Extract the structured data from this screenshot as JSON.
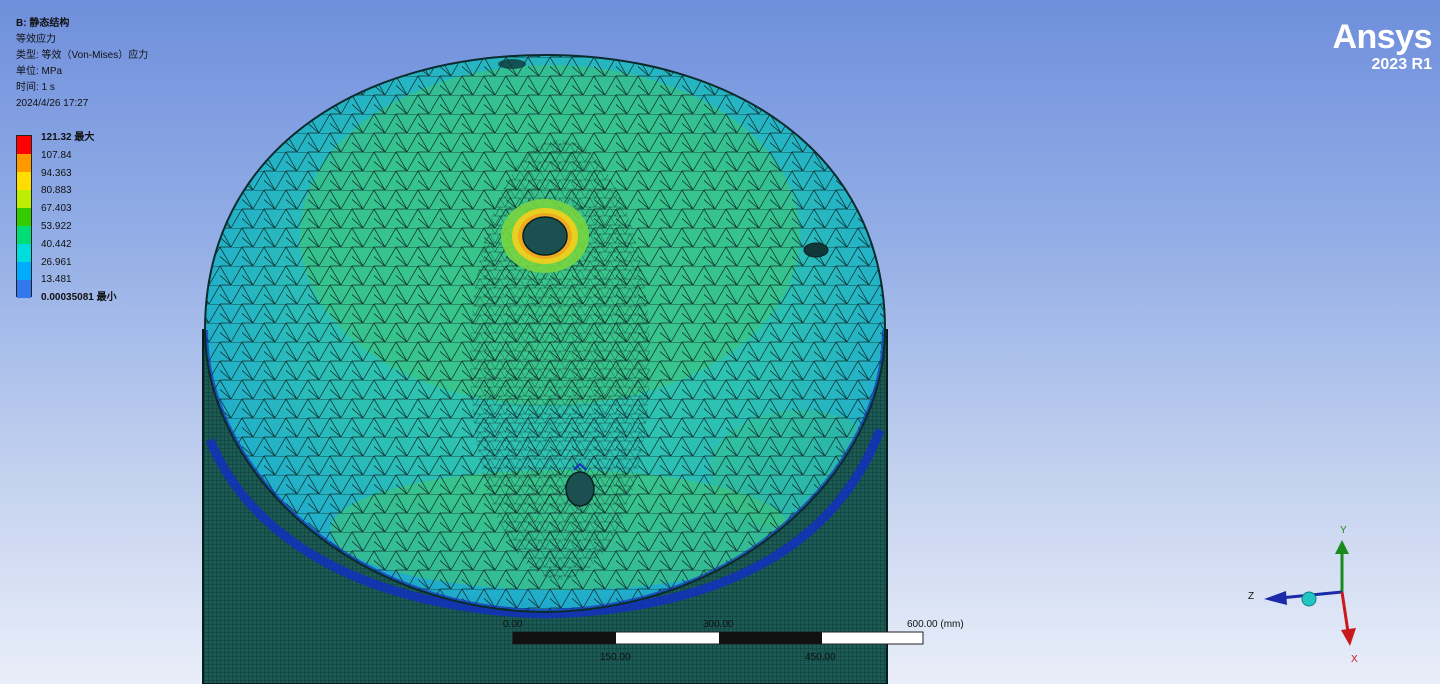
{
  "info": {
    "title": "B: 静态结构",
    "result": "等效应力",
    "type": "类型: 等效（Von-Mises）应力",
    "unit": "单位: MPa",
    "time": "时间: 1 s",
    "date": "2024/4/26 17:27"
  },
  "legend": {
    "labels": [
      "121.32 最大",
      "107.84",
      "94.363",
      "80.883",
      "67.403",
      "53.922",
      "40.442",
      "26.961",
      "13.481",
      "0.00035081 最小"
    ],
    "colors": [
      "#ff0000",
      "#ff9900",
      "#ffdd00",
      "#bbee00",
      "#33cc00",
      "#00dd77",
      "#00dddd",
      "#00aaff",
      "#3377ee",
      "#0000dd"
    ]
  },
  "brand": {
    "name": "Ansys",
    "version": "2023 R1"
  },
  "scale": {
    "labels_top": [
      "0.00",
      "300.00",
      "600.00 (mm)"
    ],
    "labels_bottom": [
      "150.00",
      "450.00"
    ]
  },
  "triad": {
    "x": "X",
    "y": "Y",
    "z": "Z"
  }
}
